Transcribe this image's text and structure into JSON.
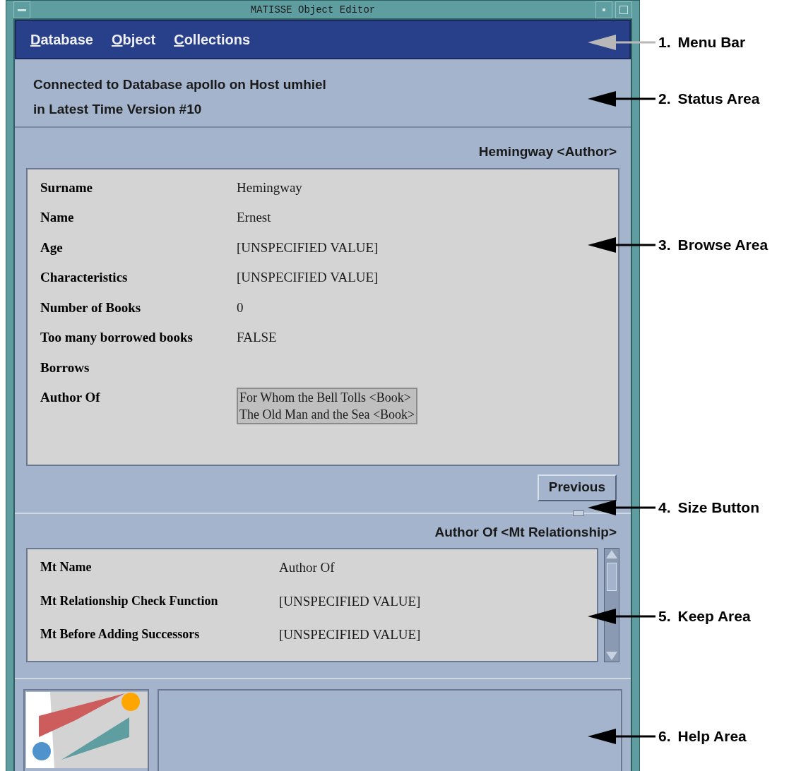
{
  "window": {
    "title": "MATISSE Object Editor"
  },
  "menu_bar": {
    "items": [
      {
        "label": "Database"
      },
      {
        "label": "Object"
      },
      {
        "label": "Collections"
      }
    ]
  },
  "status_area": {
    "lines": [
      "Connected to Database apollo on Host umhiel",
      "in Latest Time Version #10"
    ]
  },
  "browse_area": {
    "title": "Hemingway <Author>",
    "fields": [
      {
        "kind": "text",
        "label": "Surname",
        "value": "Hemingway"
      },
      {
        "kind": "text",
        "label": "Name",
        "value": "Ernest"
      },
      {
        "kind": "text",
        "label": "Age",
        "value": "[UNSPECIFIED VALUE]"
      },
      {
        "kind": "text",
        "label": "Characteristics",
        "value": "[UNSPECIFIED VALUE]"
      },
      {
        "kind": "text",
        "label": "Number of Books",
        "value": "0"
      },
      {
        "kind": "text",
        "label": "Too many borrowed books",
        "value": "FALSE"
      },
      {
        "kind": "text",
        "label": "Borrows"
      },
      {
        "kind": "list",
        "label": "Author Of",
        "values": [
          "For Whom the Bell Tolls <Book>",
          "The Old Man and the Sea <Book>"
        ]
      }
    ],
    "button": "Previous"
  },
  "keep_area": {
    "title": "Author Of <Mt Relationship>",
    "fields": [
      {
        "label": "Mt Name",
        "value": "Author Of"
      },
      {
        "label": "Mt Relationship Check Function",
        "value": "[UNSPECIFIED VALUE]"
      },
      {
        "label": "Mt Before Adding Successors",
        "value": "[UNSPECIFIED VALUE]"
      }
    ]
  },
  "callouts": [
    {
      "number": "1.",
      "label": "Menu Bar",
      "color": "#b8b8b8"
    },
    {
      "number": "2.",
      "label": "Status Area",
      "color": "#000000"
    },
    {
      "number": "3.",
      "label": "Browse Area",
      "color": "#000000"
    },
    {
      "number": "4.",
      "label": "Size Button",
      "color": "#000000"
    },
    {
      "number": "5.",
      "label": "Keep Area",
      "color": "#000000"
    },
    {
      "number": "6.",
      "label": "Help Area",
      "color": "#000000"
    }
  ]
}
